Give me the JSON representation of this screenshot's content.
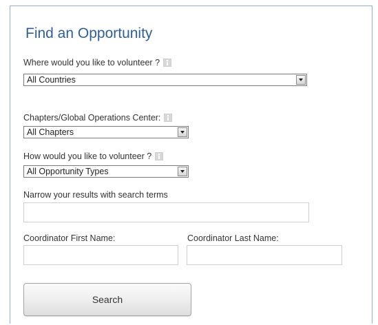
{
  "form": {
    "title": "Find an Opportunity",
    "location": {
      "label": "Where would you like to volunteer ?",
      "selected": "All Countries"
    },
    "chapter": {
      "label": "Chapters/Global Operations Center:",
      "selected": "All Chapters"
    },
    "type": {
      "label": "How would you like to volunteer ?",
      "selected": "All Opportunity Types"
    },
    "search_terms": {
      "label": "Narrow your results with search terms",
      "value": ""
    },
    "coordinator_first": {
      "label": "Coordinator First Name:",
      "value": ""
    },
    "coordinator_last": {
      "label": "Coordinator Last Name:",
      "value": ""
    },
    "search_button": "Search"
  },
  "colors": {
    "title": "#2c5f9a",
    "panel_border": "#8fb0d4",
    "label_text": "#333333"
  },
  "icons": [
    "info-icon",
    "dropdown-arrow-icon"
  ]
}
